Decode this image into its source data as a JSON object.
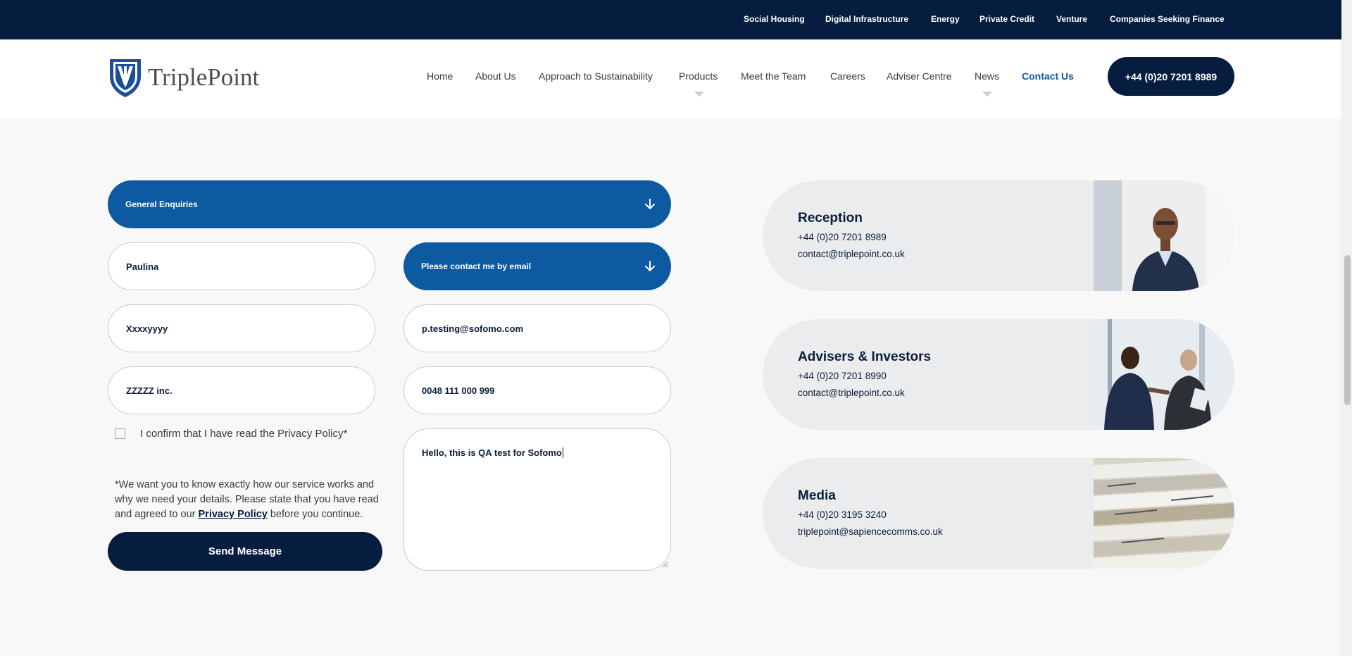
{
  "topbar": {
    "links": [
      "Social Housing",
      "Digital Infrastructure",
      "Energy",
      "Private Credit",
      "Venture",
      "Companies Seeking Finance"
    ]
  },
  "header": {
    "logo_text": "TriplePoint",
    "nav": [
      "Home",
      "About Us",
      "Approach to Sustainability",
      "Products",
      "Meet the Team",
      "Careers",
      "Adviser Centre",
      "News",
      "Contact Us"
    ],
    "active_nav": "Contact Us",
    "phone_button": "+44 (0)20 7201 8989"
  },
  "form": {
    "enquiry_type": "General Enquiries",
    "contact_preference": "Please contact me by email",
    "first_name": "Paulina",
    "last_name": "Xxxxyyyy",
    "email": "p.testing@sofomo.com",
    "company": "ZZZZZ inc.",
    "phone": "0048 111 000 999",
    "message": "Hello, this is QA test for Sofomo",
    "privacy_checkbox_label": "I confirm that I have read the Privacy Policy*",
    "privacy_checked": false,
    "disclaimer_before": "*We want you to know exactly how our service works and why we need your details. Please state that you have read and agreed to our ",
    "disclaimer_link": "Privacy Policy",
    "disclaimer_after": " before you continue.",
    "submit_label": "Send Message"
  },
  "contacts": [
    {
      "title": "Reception",
      "phone": "+44 (0)20 7201 8989",
      "email": "contact@triplepoint.co.uk"
    },
    {
      "title": "Advisers & Investors",
      "phone": "+44 (0)20 7201 8990",
      "email": "contact@triplepoint.co.uk"
    },
    {
      "title": "Media",
      "phone": "+44 (0)20 3195 3240",
      "email": "triplepoint@sapiencecomms.co.uk"
    }
  ],
  "colors": {
    "navy": "#061d40",
    "accent_blue": "#0d5aa0",
    "card_bg": "#ebecee",
    "page_bg": "#f8f8f8"
  }
}
